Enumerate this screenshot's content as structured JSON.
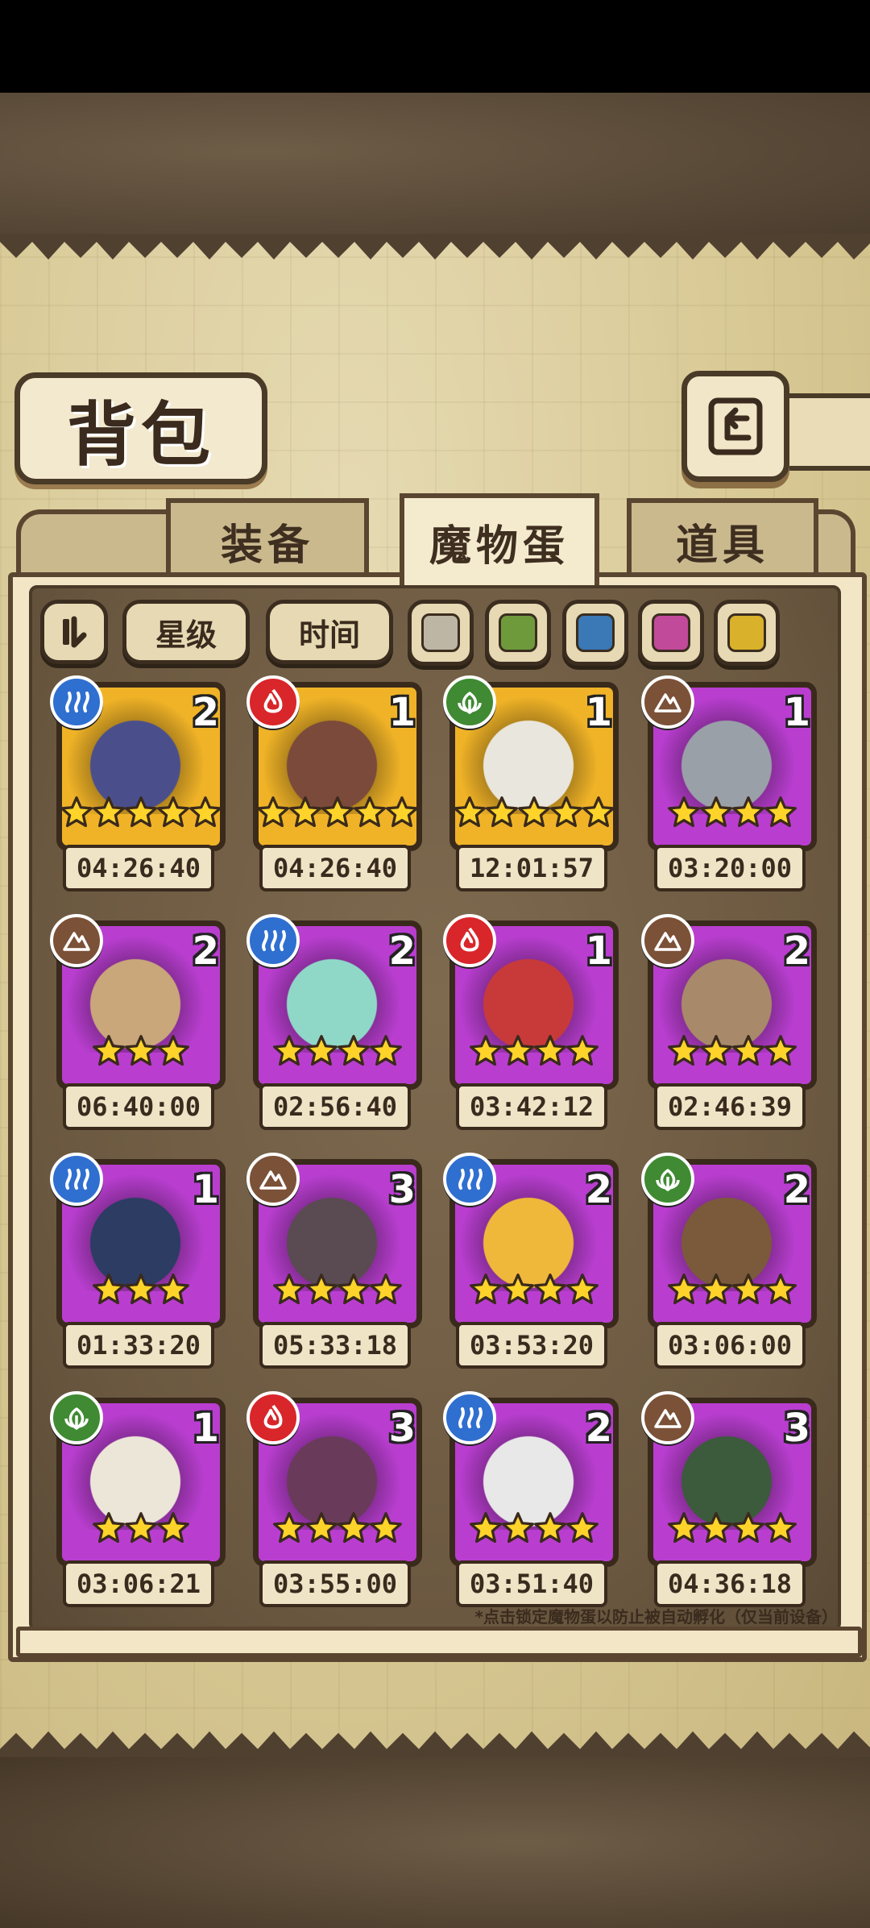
{
  "title": "背包",
  "tabs": [
    {
      "label": "装备",
      "active": false
    },
    {
      "label": "魔物蛋",
      "active": true
    },
    {
      "label": "道具",
      "active": false
    }
  ],
  "filters": {
    "sort_icon": "pause-sort-icon",
    "star_label": "星级",
    "time_label": "时间",
    "rarity_colors": [
      "#bdb6a4",
      "#6e9a3c",
      "#3a78b6",
      "#c24a9a",
      "#d9b12a"
    ]
  },
  "element_colors": {
    "water": "#2f6fd0",
    "fire": "#d8262a",
    "leaf": "#3f8a32",
    "earth": "#7b5138"
  },
  "rarity_colors": {
    "gold": "#f0b327",
    "purple": "#b93ed0"
  },
  "eggs": [
    {
      "element": "water",
      "rarity": "gold",
      "count": "2",
      "stars": 5,
      "time": "04:26:40",
      "art": "dark-feather-egg"
    },
    {
      "element": "fire",
      "rarity": "gold",
      "count": "1",
      "stars": 5,
      "time": "04:26:40",
      "art": "crossbow-egg"
    },
    {
      "element": "leaf",
      "rarity": "gold",
      "count": "1",
      "stars": 5,
      "time": "12:01:57",
      "art": "laurel-egg"
    },
    {
      "element": "earth",
      "rarity": "purple",
      "count": "1",
      "stars": 4,
      "time": "03:20:00",
      "art": "sword-egg"
    },
    {
      "element": "earth",
      "rarity": "purple",
      "count": "2",
      "stars": 3,
      "time": "06:40:00",
      "art": "vine-egg"
    },
    {
      "element": "water",
      "rarity": "purple",
      "count": "2",
      "stars": 4,
      "time": "02:56:40",
      "art": "wing-web-egg"
    },
    {
      "element": "fire",
      "rarity": "purple",
      "count": "1",
      "stars": 4,
      "time": "03:42:12",
      "art": "red-horn-egg"
    },
    {
      "element": "earth",
      "rarity": "purple",
      "count": "2",
      "stars": 4,
      "time": "02:46:39",
      "art": "gear-egg"
    },
    {
      "element": "water",
      "rarity": "purple",
      "count": "1",
      "stars": 3,
      "time": "01:33:20",
      "art": "coil-egg"
    },
    {
      "element": "earth",
      "rarity": "purple",
      "count": "3",
      "stars": 4,
      "time": "05:33:18",
      "art": "bow-egg"
    },
    {
      "element": "water",
      "rarity": "purple",
      "count": "2",
      "stars": 4,
      "time": "03:53:20",
      "art": "jelly-egg"
    },
    {
      "element": "leaf",
      "rarity": "purple",
      "count": "2",
      "stars": 4,
      "time": "03:06:00",
      "art": "tiger-egg"
    },
    {
      "element": "leaf",
      "rarity": "purple",
      "count": "1",
      "stars": 3,
      "time": "03:06:21",
      "art": "owl-egg"
    },
    {
      "element": "fire",
      "rarity": "purple",
      "count": "3",
      "stars": 4,
      "time": "03:55:00",
      "art": "bat-egg"
    },
    {
      "element": "water",
      "rarity": "purple",
      "count": "2",
      "stars": 4,
      "time": "03:51:40",
      "art": "panda-mask-egg"
    },
    {
      "element": "earth",
      "rarity": "purple",
      "count": "3",
      "stars": 4,
      "time": "04:36:18",
      "art": "scarf-egg"
    }
  ],
  "note": "*点击锁定魔物蛋以防止被自动孵化（仅当前设备）"
}
